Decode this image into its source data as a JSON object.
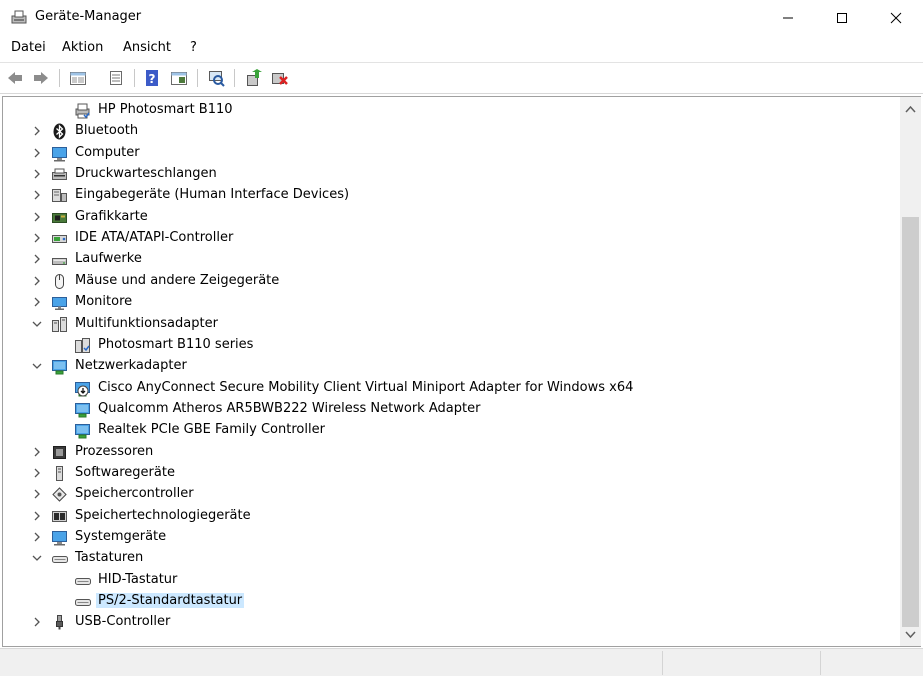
{
  "window": {
    "title": "Geräte-Manager"
  },
  "menu": [
    "Datei",
    "Aktion",
    "Ansicht",
    "?"
  ],
  "toolbar": [
    "back-icon",
    "forward-icon",
    "properties-view-icon",
    "list-view-icon",
    "help-icon",
    "console-tree-icon",
    "scan-hardware-icon",
    "update-driver-icon",
    "uninstall-device-icon"
  ],
  "tree": [
    {
      "label": "HP Photosmart B110",
      "level": 1,
      "icon": "printer-icon",
      "expander": "none"
    },
    {
      "label": "Bluetooth",
      "level": 0,
      "icon": "bluetooth-icon",
      "expander": "collapsed"
    },
    {
      "label": "Computer",
      "level": 0,
      "icon": "computer-icon",
      "expander": "collapsed"
    },
    {
      "label": "Druckwarteschlangen",
      "level": 0,
      "icon": "print-queue-icon",
      "expander": "collapsed"
    },
    {
      "label": "Eingabegeräte (Human Interface Devices)",
      "level": 0,
      "icon": "hid-icon",
      "expander": "collapsed"
    },
    {
      "label": "Grafikkarte",
      "level": 0,
      "icon": "display-adapter-icon",
      "expander": "collapsed"
    },
    {
      "label": "IDE ATA/ATAPI-Controller",
      "level": 0,
      "icon": "ide-controller-icon",
      "expander": "collapsed"
    },
    {
      "label": "Laufwerke",
      "level": 0,
      "icon": "disk-drive-icon",
      "expander": "collapsed"
    },
    {
      "label": "Mäuse und andere Zeigegeräte",
      "level": 0,
      "icon": "mouse-icon",
      "expander": "collapsed"
    },
    {
      "label": "Monitore",
      "level": 0,
      "icon": "monitor-icon",
      "expander": "collapsed"
    },
    {
      "label": "Multifunktionsadapter",
      "level": 0,
      "icon": "multifunction-adapter-icon",
      "expander": "expanded"
    },
    {
      "label": "Photosmart B110 series",
      "level": 1,
      "icon": "multifunction-device-icon",
      "expander": "none"
    },
    {
      "label": "Netzwerkadapter",
      "level": 0,
      "icon": "network-adapter-icon",
      "expander": "expanded"
    },
    {
      "label": "Cisco AnyConnect Secure Mobility Client Virtual Miniport Adapter for Windows x64",
      "level": 1,
      "icon": "network-adapter-warning-icon",
      "expander": "none"
    },
    {
      "label": "Qualcomm Atheros AR5BWB222 Wireless Network Adapter",
      "level": 1,
      "icon": "network-adapter-icon",
      "expander": "none"
    },
    {
      "label": "Realtek PCIe GBE Family Controller",
      "level": 1,
      "icon": "network-adapter-icon",
      "expander": "none"
    },
    {
      "label": "Prozessoren",
      "level": 0,
      "icon": "processor-icon",
      "expander": "collapsed"
    },
    {
      "label": "Softwaregeräte",
      "level": 0,
      "icon": "software-device-icon",
      "expander": "collapsed"
    },
    {
      "label": "Speichercontroller",
      "level": 0,
      "icon": "storage-controller-icon",
      "expander": "collapsed"
    },
    {
      "label": "Speichertechnologiegeräte",
      "level": 0,
      "icon": "memory-technology-icon",
      "expander": "collapsed"
    },
    {
      "label": "Systemgeräte",
      "level": 0,
      "icon": "system-device-icon",
      "expander": "collapsed"
    },
    {
      "label": "Tastaturen",
      "level": 0,
      "icon": "keyboard-icon",
      "expander": "expanded"
    },
    {
      "label": "HID-Tastatur",
      "level": 1,
      "icon": "keyboard-icon",
      "expander": "none"
    },
    {
      "label": "PS/2-Standardtastatur",
      "level": 1,
      "icon": "keyboard-icon",
      "expander": "none",
      "selected": true
    },
    {
      "label": "USB-Controller",
      "level": 0,
      "icon": "usb-controller-icon",
      "expander": "collapsed"
    }
  ],
  "colors": {
    "selection": "#cce8ff",
    "accent": "#0078d7"
  }
}
